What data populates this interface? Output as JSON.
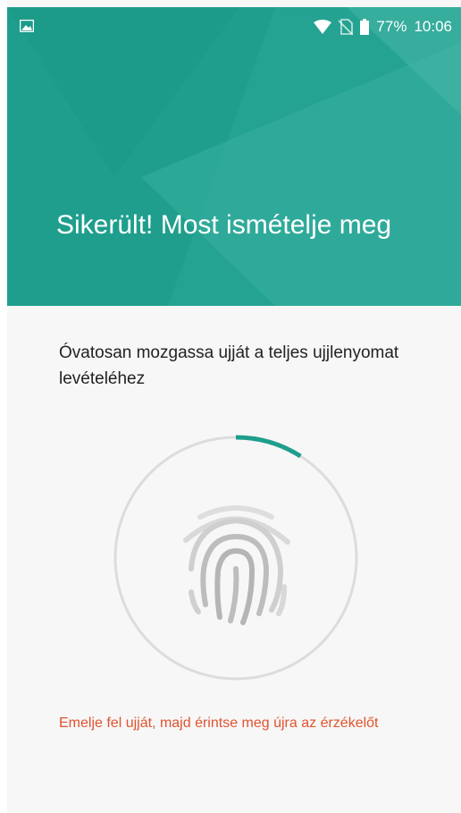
{
  "status_bar": {
    "battery_percent": "77%",
    "time": "10:06",
    "icons": [
      "image-notification-icon",
      "wifi-icon",
      "no-sim-icon",
      "battery-icon"
    ]
  },
  "header": {
    "title": "Sikerült! Most ismételje meg",
    "color": "#1f9e8d"
  },
  "body": {
    "instruction": "Óvatosan mozgassa ujját a teljes ujjlenyomat levételéhez",
    "error_message": "Emelje fel ujját, majd érintse meg újra az érzékelőt"
  },
  "enrollment": {
    "progress_fraction": 0.09,
    "progress_color": "#1f9e8d",
    "track_color": "#dcdcdc"
  }
}
